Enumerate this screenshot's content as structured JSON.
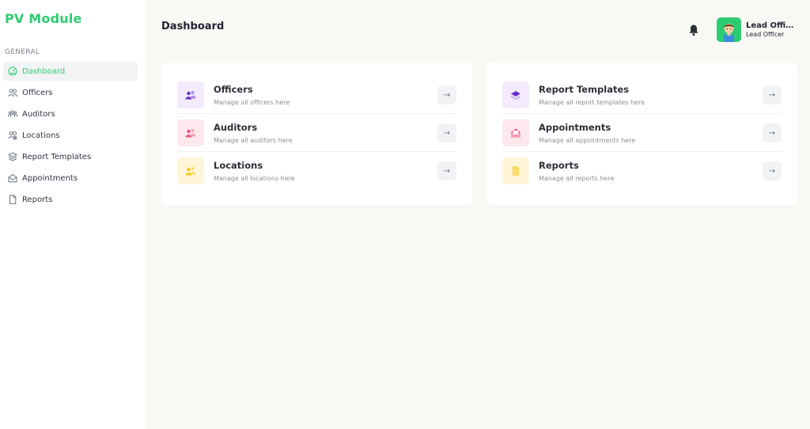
{
  "app": {
    "brand": "PV Module"
  },
  "sidebar": {
    "section_label": "GENERAL",
    "items": [
      {
        "label": "Dashboard",
        "icon": "gauge-icon",
        "active": true
      },
      {
        "label": "Officers",
        "icon": "users-icon"
      },
      {
        "label": "Auditors",
        "icon": "group-icon"
      },
      {
        "label": "Locations",
        "icon": "user-location-icon"
      },
      {
        "label": "Report Templates",
        "icon": "layers-icon"
      },
      {
        "label": "Appointments",
        "icon": "envelope-open-icon"
      },
      {
        "label": "Reports",
        "icon": "file-icon"
      }
    ]
  },
  "header": {
    "title": "Dashboard",
    "user": {
      "name": "Lead Offic...",
      "role": "Lead Officer"
    }
  },
  "cards": {
    "left": [
      {
        "title": "Officers",
        "subtitle": "Manage all officers here",
        "icon": "people-icon",
        "tile_color": "#f3eafc",
        "icon_color": "#6b2fc9"
      },
      {
        "title": "Auditors",
        "subtitle": "Manage all auditors here",
        "icon": "people-icon",
        "tile_color": "#fde8ee",
        "icon_color": "#f0507a"
      },
      {
        "title": "Locations",
        "subtitle": "Manage all locations here",
        "icon": "people-icon",
        "tile_color": "#fff6d9",
        "icon_color": "#f5c518"
      }
    ],
    "right": [
      {
        "title": "Report Templates",
        "subtitle": "Manage all report templates here",
        "icon": "layers-icon",
        "tile_color": "#f3eafc",
        "icon_color": "#6b2fc9"
      },
      {
        "title": "Appointments",
        "subtitle": "Manage all appointments here",
        "icon": "envelope-open-icon",
        "tile_color": "#fde8ee",
        "icon_color": "#f0507a"
      },
      {
        "title": "Reports",
        "subtitle": "Manage all reports here",
        "icon": "document-icon",
        "tile_color": "#fff6d9",
        "icon_color": "#f5c518"
      }
    ]
  },
  "colors": {
    "accent": "#2ecc71",
    "background": "#f9f8f5"
  },
  "arrow_glyph": "→"
}
